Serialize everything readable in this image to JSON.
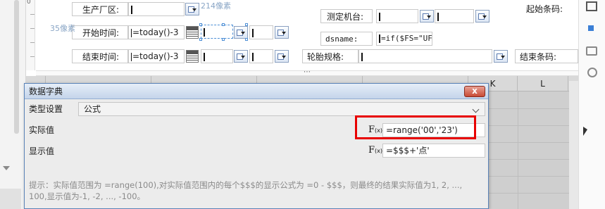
{
  "ruler": {
    "mark": "0"
  },
  "form": {
    "rows": [
      {
        "label": "生产厂区:",
        "value": ""
      },
      {
        "label": "开始时间:",
        "value": "=today()-3"
      },
      {
        "label": "结束时间:",
        "value": "=today()-3"
      }
    ],
    "notes": {
      "width_note": "214像素",
      "height_note": "35像素"
    },
    "middle": {
      "machine_label": "测定机台:",
      "dsname_label": "dsname:",
      "dsname_value": "=if($FS=\"UF\",",
      "tire_label": "轮胎规格:"
    },
    "right": {
      "start_code_label": "起始条码:",
      "end_code_label": "结束条码:"
    },
    "splitter": "⋯"
  },
  "grid": {
    "columns": [
      "K",
      "L"
    ]
  },
  "dialog": {
    "title": "数据字典",
    "close_label": "x",
    "type_label": "类型设置",
    "type_value": "公式",
    "actual_label": "实际值",
    "actual_fx": "F",
    "actual_fx_sub": "(x)",
    "actual_value": "=range('00','23')",
    "display_label": "显示值",
    "display_fx": "F",
    "display_fx_sub": "(x)",
    "display_value": "=$$$+'点'",
    "hint": "提示：实际值范围为 =range(100),对实际值范围内的每个$$$的显示公式为 =0 - $$$，则最终的结果实际值为1, 2, ..., 100,显示值为-1, -2, ..., -100。"
  },
  "right_rail": {
    "icons": [
      "square-frame-icon",
      "blue-square-icon",
      "layers-icon",
      "link-icon"
    ]
  },
  "colors": {
    "highlight_border": "#e80000",
    "dialog_border": "#5a83b8",
    "selection": "#4d8fd6"
  }
}
